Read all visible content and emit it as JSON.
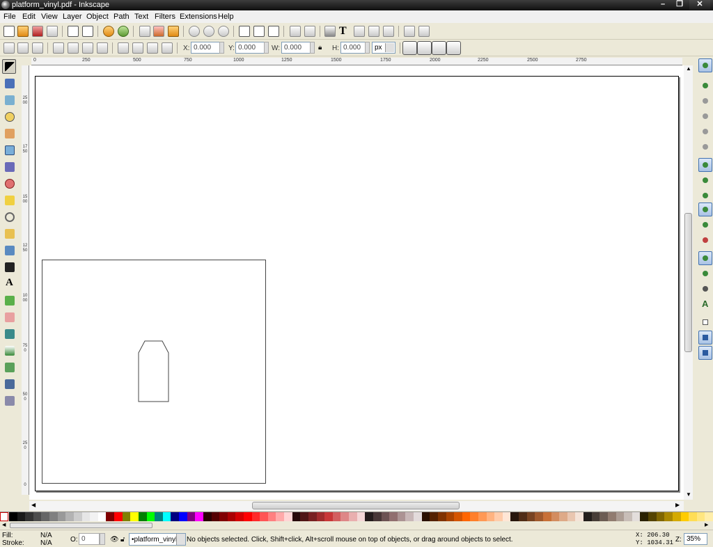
{
  "window": {
    "title": "platform_vinyl.pdf - Inkscape"
  },
  "menu": [
    "File",
    "Edit",
    "View",
    "Layer",
    "Object",
    "Path",
    "Text",
    "Filters",
    "Extensions",
    "Help"
  ],
  "ctrl": {
    "x_label": "X:",
    "x_value": "0.000",
    "y_label": "Y:",
    "y_value": "0.000",
    "w_label": "W:",
    "w_value": "0.000",
    "h_label": "H:",
    "h_value": "0.000",
    "unit": "px"
  },
  "ruler": {
    "h_labels": [
      "0",
      "250",
      "500",
      "750",
      "1000",
      "1250",
      "1500",
      "1750",
      "2000",
      "2250",
      "2500",
      "2750"
    ],
    "v_labels": [
      "2500",
      "1750",
      "1500",
      "1250",
      "1000",
      "750",
      "500",
      "250",
      "0"
    ]
  },
  "status": {
    "fill_label": "Fill:",
    "fill_value": "N/A",
    "stroke_label": "Stroke:",
    "stroke_value": "N/A",
    "opacity_label": "O:",
    "opacity_value": "0",
    "layer": "•platform_vinyl",
    "message": "No objects selected. Click, Shift+click, Alt+scroll mouse on top of objects, or drag around objects to select.",
    "x_coord": "X:  206.30",
    "y_coord": "Y: 1034.31",
    "zoom_label": "Z:",
    "zoom": "35%"
  },
  "colors": {
    "palette": [
      "#000000",
      "#1a1a1a",
      "#333333",
      "#4d4d4d",
      "#666666",
      "#808080",
      "#999999",
      "#b3b3b3",
      "#cccccc",
      "#e6e6e6",
      "#f2f2f2",
      "#ffffff",
      "#800000",
      "#ff0000",
      "#808000",
      "#ffff00",
      "#008000",
      "#00ff00",
      "#008080",
      "#00ffff",
      "#000080",
      "#0000ff",
      "#800080",
      "#ff00ff",
      "#2b0000",
      "#550000",
      "#800000",
      "#aa0000",
      "#d40000",
      "#ff0000",
      "#ff2a2a",
      "#ff5555",
      "#ff8080",
      "#ffaaaa",
      "#ffd5d5",
      "#280b0b",
      "#501616",
      "#782121",
      "#a02c2c",
      "#c83737",
      "#d35f5f",
      "#de8787",
      "#e9afaf",
      "#f4d7d7",
      "#241c1c",
      "#483737",
      "#6c5353",
      "#916f6f",
      "#ac9393",
      "#c8b7b7",
      "#e3dbdb",
      "#2b1100",
      "#552200",
      "#803300",
      "#aa4400",
      "#d45500",
      "#ff6600",
      "#ff7f2a",
      "#ff9955",
      "#ffb380",
      "#ffccaa",
      "#ffe6d5",
      "#28170b",
      "#502d16",
      "#784421",
      "#a05a2c",
      "#c87137",
      "#d38d5f",
      "#deaa87",
      "#e9c6af",
      "#f4e3d7",
      "#241f1c",
      "#483e37",
      "#6c5d53",
      "#917c6f",
      "#ac9d93",
      "#c8beb7",
      "#e3dedb",
      "#2b2200",
      "#554400",
      "#806600",
      "#aa8800",
      "#d4aa00",
      "#ffcc00",
      "#ffdd55",
      "#ffe680",
      "#ffeeaa"
    ]
  }
}
